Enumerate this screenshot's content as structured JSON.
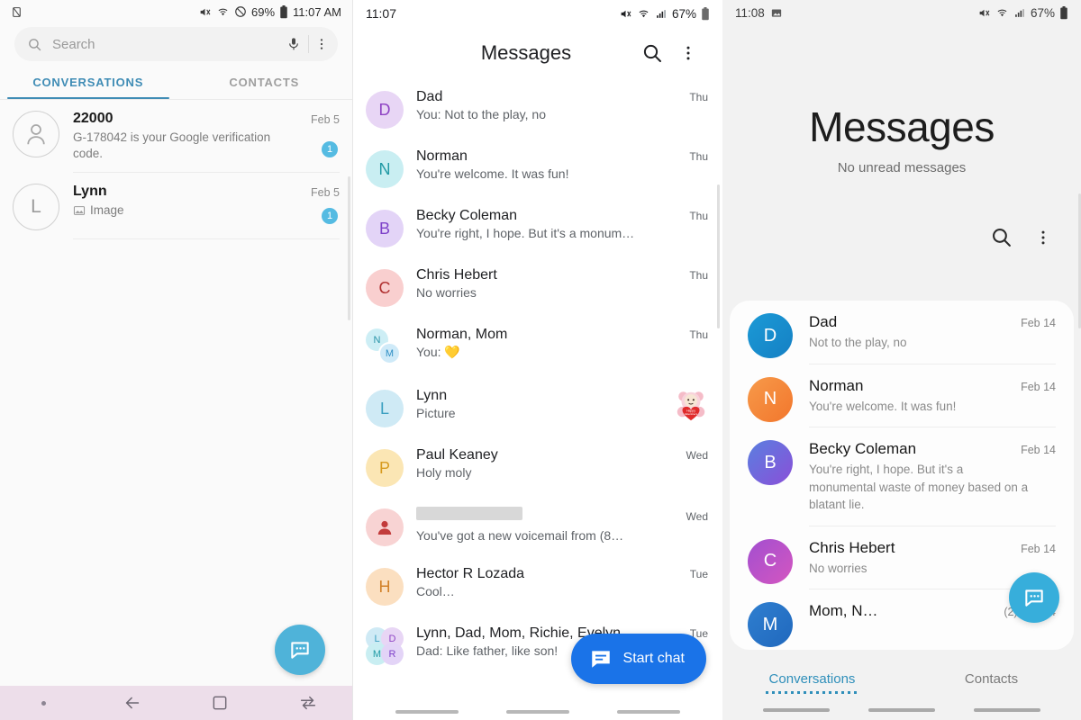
{
  "panel1": {
    "status": {
      "time": "11:07 AM",
      "battery": "69%",
      "icons": [
        "sim-card-off-icon",
        "mute-icon",
        "wifi-icon",
        "do-not-disturb-icon",
        "battery-icon"
      ]
    },
    "search": {
      "placeholder": "Search",
      "value": "",
      "mic_icon": "microphone-icon",
      "more_icon": "more-vertical-icon",
      "search_icon": "search-icon"
    },
    "tabs": [
      {
        "label": "CONVERSATIONS",
        "active": true
      },
      {
        "label": "CONTACTS",
        "active": false
      }
    ],
    "conversations": [
      {
        "name": "22000",
        "preview": "G-178042 is your Google verification code.",
        "date": "Feb 5",
        "badge": "1",
        "avatar_type": "person-outline",
        "avatar_letter": ""
      },
      {
        "name": "Lynn",
        "preview": "Image",
        "date": "Feb 5",
        "badge": "1",
        "avatar_type": "letter",
        "avatar_letter": "L",
        "preview_icon": "image-icon"
      }
    ],
    "fab": {
      "icon": "new-message-icon",
      "color": "#4fb3d9"
    },
    "navbar": {
      "items": [
        "recents-dot",
        "back-icon",
        "home-icon",
        "switch-icon"
      ]
    }
  },
  "panel2": {
    "status": {
      "time": "11:07",
      "battery": "67%",
      "icons": [
        "mute-icon",
        "wifi-icon",
        "signal-icon",
        "battery-icon"
      ]
    },
    "appbar": {
      "title": "Messages",
      "search_icon": "search-icon",
      "more_icon": "more-vertical-icon"
    },
    "conversations": [
      {
        "name": "Dad",
        "preview": "You: Not to the play, no",
        "date": "Thu",
        "letter": "D",
        "bg": "#e8d6f5",
        "fg": "#8e44c4"
      },
      {
        "name": "Norman",
        "preview": "You're welcome. It was fun!",
        "date": "Thu",
        "letter": "N",
        "bg": "#c9eef2",
        "fg": "#219aa5"
      },
      {
        "name": "Becky Coleman",
        "preview": "You're right, I hope. But it's a monum…",
        "date": "Thu",
        "letter": "B",
        "bg": "#e3d4f7",
        "fg": "#7e42c9"
      },
      {
        "name": "Chris Hebert",
        "preview": "No worries",
        "date": "Thu",
        "letter": "C",
        "bg": "#f9cfcf",
        "fg": "#b03030"
      },
      {
        "name": "Norman, Mom",
        "preview": "You: 💛",
        "date": "Thu",
        "group": true,
        "letters": [
          "N",
          "M"
        ],
        "bgs": [
          "#cdeef5",
          "#cfeaf8"
        ],
        "fgs": [
          "#2a94a8",
          "#2f8fc4"
        ]
      },
      {
        "name": "Lynn",
        "preview": "Picture",
        "date": "",
        "letter": "L",
        "bg": "#cfeaf5",
        "fg": "#3a9fc0",
        "thumbnail": "valentine-bear-sticker"
      },
      {
        "name": "Paul Keaney",
        "preview": "Holy moly",
        "date": "Wed",
        "letter": "P",
        "bg": "#fbe6b4",
        "fg": "#d79b20"
      },
      {
        "name": "",
        "preview": "You've got a new voicemail from (8…",
        "date": "Wed",
        "letter": "",
        "bg": "#f8d3d3",
        "fg": "#c23b3b",
        "name_redacted": true,
        "avatar_type": "person-solid"
      },
      {
        "name": "Hector R Lozada",
        "preview": "Cool…",
        "date": "Tue",
        "letter": "H",
        "bg": "#fbdfc0",
        "fg": "#d2822a"
      },
      {
        "name": "Lynn, Dad, Mom, Richie, Evelyn",
        "preview": "Dad: Like father, like son!",
        "date": "Tue",
        "group": true,
        "letters": [
          "L",
          "D",
          "M",
          "R"
        ],
        "bgs": [
          "#cfeaf5",
          "#e8d6f5",
          "#c9eef2",
          "#e3d4f7"
        ],
        "fgs": [
          "#3a9fc0",
          "#8e44c4",
          "#219aa5",
          "#7e42c9"
        ]
      }
    ],
    "fab": {
      "label": "Start chat",
      "icon": "chat-bubble-icon",
      "color": "#1a73e8"
    }
  },
  "panel3": {
    "status": {
      "time": "11:08",
      "battery": "67%",
      "icons": [
        "image-icon",
        "mute-icon",
        "wifi-icon",
        "signal-icon",
        "battery-icon"
      ]
    },
    "hero": {
      "title": "Messages",
      "subtitle": "No unread messages"
    },
    "actions": {
      "search_icon": "search-icon",
      "more_icon": "more-vertical-icon"
    },
    "conversations": [
      {
        "name": "Dad",
        "preview": "Not to the play, no",
        "date": "Feb 14",
        "letter": "D",
        "bg": "linear-gradient(135deg,#1b9ad6,#1580c4)"
      },
      {
        "name": "Norman",
        "preview": "You're welcome. It was fun!",
        "date": "Feb 14",
        "letter": "N",
        "bg": "linear-gradient(135deg,#f79a4a,#f2762c)"
      },
      {
        "name": "Becky Coleman",
        "preview": "You're right, I hope. But it's a monumental waste of money based on a blatant lie.",
        "date": "Feb 14",
        "letter": "B",
        "bg": "linear-gradient(135deg,#5a7fe0,#8a4fd8)"
      },
      {
        "name": "Chris Hebert",
        "preview": "No worries",
        "date": "Feb 14",
        "letter": "C",
        "bg": "linear-gradient(135deg,#a24fd0,#d456c0)"
      },
      {
        "name": "Mom, N…",
        "preview": "",
        "date": "(2)  Feb 14",
        "letter": "M",
        "bg": "linear-gradient(135deg,#2f7fd0,#2068bd)",
        "partial": true
      }
    ],
    "fab": {
      "icon": "new-message-icon",
      "color": "#37aedb"
    },
    "tabs": [
      {
        "label": "Conversations",
        "active": true
      },
      {
        "label": "Contacts",
        "active": false
      }
    ]
  }
}
